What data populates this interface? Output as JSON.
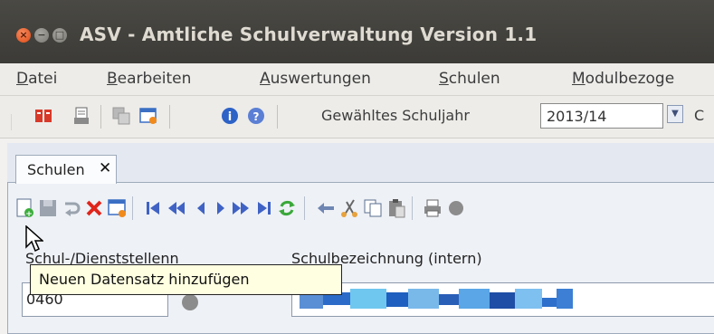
{
  "window": {
    "title": "ASV - Amtliche Schulverwaltung Version 1.1",
    "buttons": {
      "close": "×",
      "minimize": "−",
      "maximize": "□"
    }
  },
  "menu": {
    "items": [
      {
        "label": "Datei"
      },
      {
        "label": "Bearbeiten"
      },
      {
        "label": "Auswertungen"
      },
      {
        "label": "Schulen"
      },
      {
        "label": "Modulbezoge"
      }
    ]
  },
  "toolbar": {
    "schuljahr_label": "Gewähltes Schuljahr",
    "schuljahr_value": "2013/14",
    "trailing_char": "C",
    "icons": [
      "book-icon",
      "printer-list-icon",
      "copy-windows-icon",
      "window-warning-icon",
      "info-icon",
      "help-icon"
    ]
  },
  "tabs": [
    {
      "label": "Schulen",
      "close": "✕"
    }
  ],
  "record_toolbar": {
    "icons": [
      "new-record-icon",
      "save-icon",
      "undo-icon",
      "delete-icon",
      "edit-form-icon",
      "first-record-icon",
      "previous-page-icon",
      "previous-record-icon",
      "next-record-icon",
      "next-page-icon",
      "last-record-icon",
      "refresh-icon",
      "back-arrow-icon",
      "cut-icon",
      "copy-icon",
      "paste-icon",
      "print-icon"
    ]
  },
  "form": {
    "school_number_label": "Schul-/Dienststellenn",
    "school_number_value": "0460",
    "school_name_label": "Schulbezeichnung (intern)"
  },
  "tooltip": {
    "text": "Neuen Datensatz hinzufügen"
  }
}
